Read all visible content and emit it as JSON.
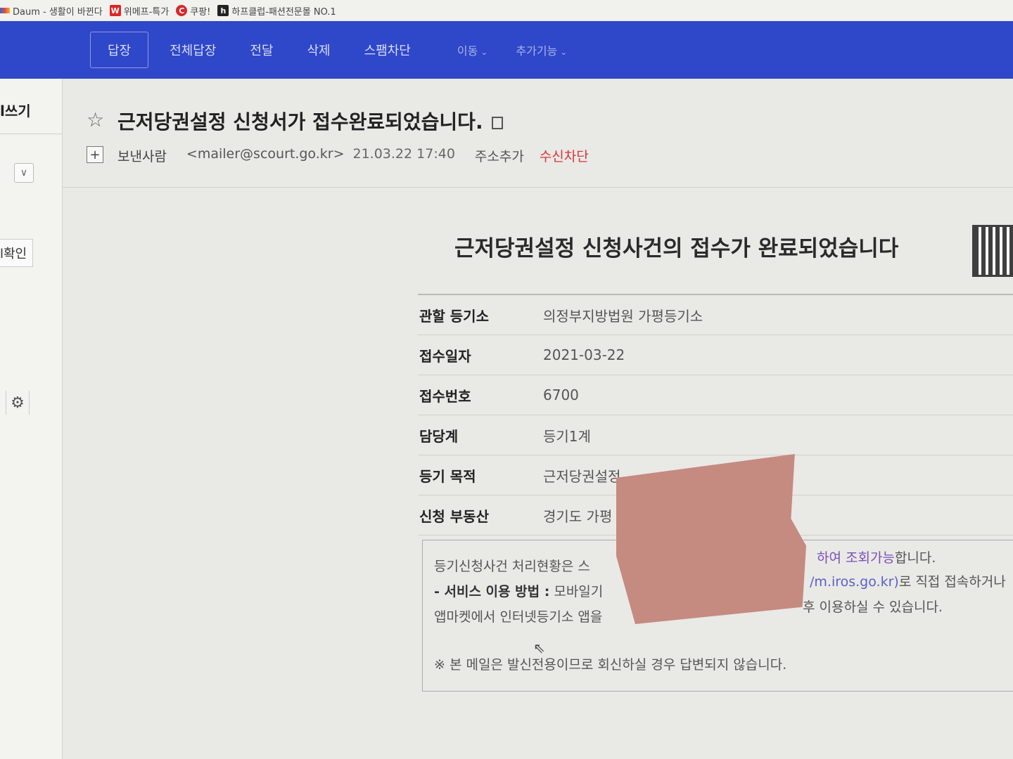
{
  "bookmarks": [
    {
      "icon": "daum-logo-icon",
      "label": "Daum - 생활이 바뀐다"
    },
    {
      "icon": "wemakeprice-icon",
      "label": "위메프-특가"
    },
    {
      "icon": "coupang-icon",
      "label": "쿠팡!"
    },
    {
      "icon": "halfclub-icon",
      "label": "하프클럽-패션전문몰 NO.1"
    }
  ],
  "toolbar": {
    "reply": "답장",
    "reply_all": "전체답장",
    "forward": "전달",
    "delete": "삭제",
    "spam_block": "스팸차단",
    "move": "이동",
    "more": "추가기능"
  },
  "sidebar": {
    "write": "l쓰기",
    "confirm": "l확인"
  },
  "mail": {
    "subject": "근저당권설정 신청서가 접수완료되었습니다.",
    "sender_label": "보낸사람",
    "sender_email": "<mailer@scourt.go.kr>",
    "date": "21.03.22 17:40",
    "add_address": "주소추가",
    "block_receive": "수신차단"
  },
  "body": {
    "title": "근저당권설정 신청사건의 접수가 완료되었습니다",
    "rows": [
      {
        "key": "관할 등기소",
        "value": "의정부지방법원 가평등기소"
      },
      {
        "key": "접수일자",
        "value": "2021-03-22"
      },
      {
        "key": "접수번호",
        "value": "6700"
      },
      {
        "key": "담당계",
        "value": "등기1계"
      },
      {
        "key": "등기 목적",
        "value": "근저당권설정"
      },
      {
        "key": "신청 부동산",
        "value": "경기도 가평"
      }
    ],
    "notice_line1": "등기신청사건 처리현황은 스",
    "notice_line1_right_link": "하여 조회가능",
    "notice_line1_right": "합니다.",
    "notice_line2_bold": "- 서비스 이용 방법 :",
    "notice_line2": " 모바일기",
    "notice_line2_right_link": "/m.iros.go.kr)",
    "notice_line2_right": "로 직접 접속하거나",
    "notice_line3": "앱마켓에서 인터넷등기소 앱을",
    "notice_line3_right": "후 이용하실 수 있습니다.",
    "notice_footer": "※ 본 메일은 발신전용이므로 회신하실 경우 답변되지 않습니다."
  },
  "colors": {
    "toolbar_bg": "#2f47c9",
    "block_receive": "#d8343a",
    "redaction": "#c58a80"
  }
}
